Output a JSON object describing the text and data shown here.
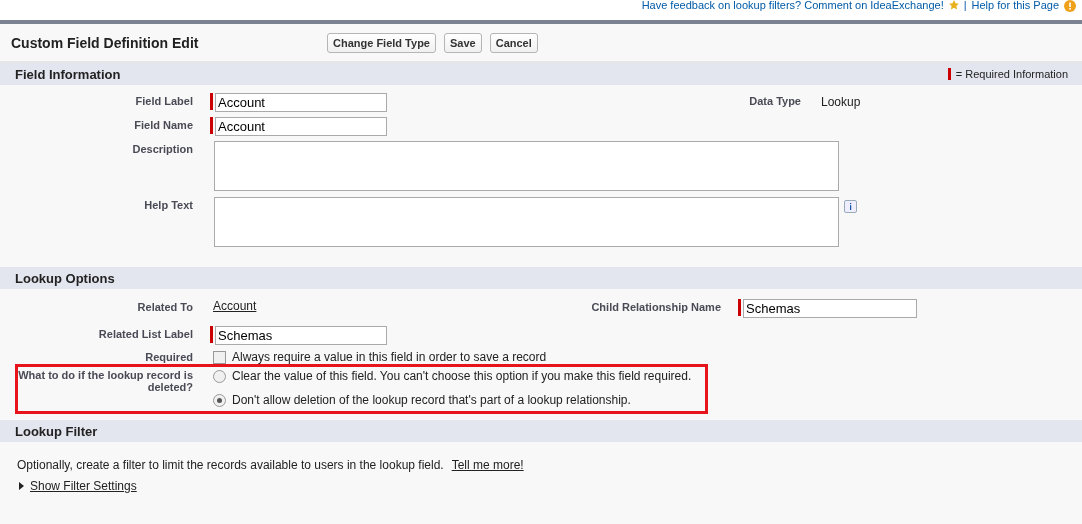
{
  "top_links": {
    "feedback": "Have feedback on lookup filters? Comment on IdeaExchange!",
    "separator": "|",
    "help": "Help for this Page"
  },
  "header": {
    "title": "Custom Field Definition Edit",
    "buttons": [
      "Change Field Type",
      "Save",
      "Cancel"
    ]
  },
  "field_information": {
    "title": "Field Information",
    "legend": "= Required Information",
    "fields": [
      {
        "label": "Field Label",
        "value": "Account",
        "required": true,
        "kind": "input"
      },
      {
        "label": "Field Name",
        "value": "Account",
        "required": true,
        "kind": "input"
      },
      {
        "label": "Description",
        "kind": "textarea",
        "info": false
      },
      {
        "label": "Help Text",
        "kind": "textarea",
        "info": true
      }
    ],
    "data_type": {
      "label": "Data Type",
      "value": "Lookup"
    }
  },
  "lookup_options": {
    "title": "Lookup Options",
    "related_to": {
      "label": "Related To",
      "value": "Account"
    },
    "child_relationship": {
      "label": "Child Relationship Name",
      "value": "Schemas",
      "required": true
    },
    "related_list_label": {
      "label": "Related List Label",
      "value": "Schemas",
      "required": true
    },
    "required": {
      "label": "Required",
      "text": "Always require a value in this field in order to save a record",
      "checked": false
    },
    "delete_behavior": {
      "label": "What to do if the lookup record is deleted?",
      "options": [
        {
          "text": "Clear the value of this field. You can't choose this option if you make this field required.",
          "selected": false
        },
        {
          "text": "Don't allow deletion of the lookup record that's part of a lookup relationship.",
          "selected": true
        }
      ]
    }
  },
  "lookup_filter": {
    "title": "Lookup Filter",
    "description": "Optionally, create a filter to limit the records available to users in the lookup field.",
    "link": "Tell me more!",
    "toggle": "Show Filter Settings"
  }
}
